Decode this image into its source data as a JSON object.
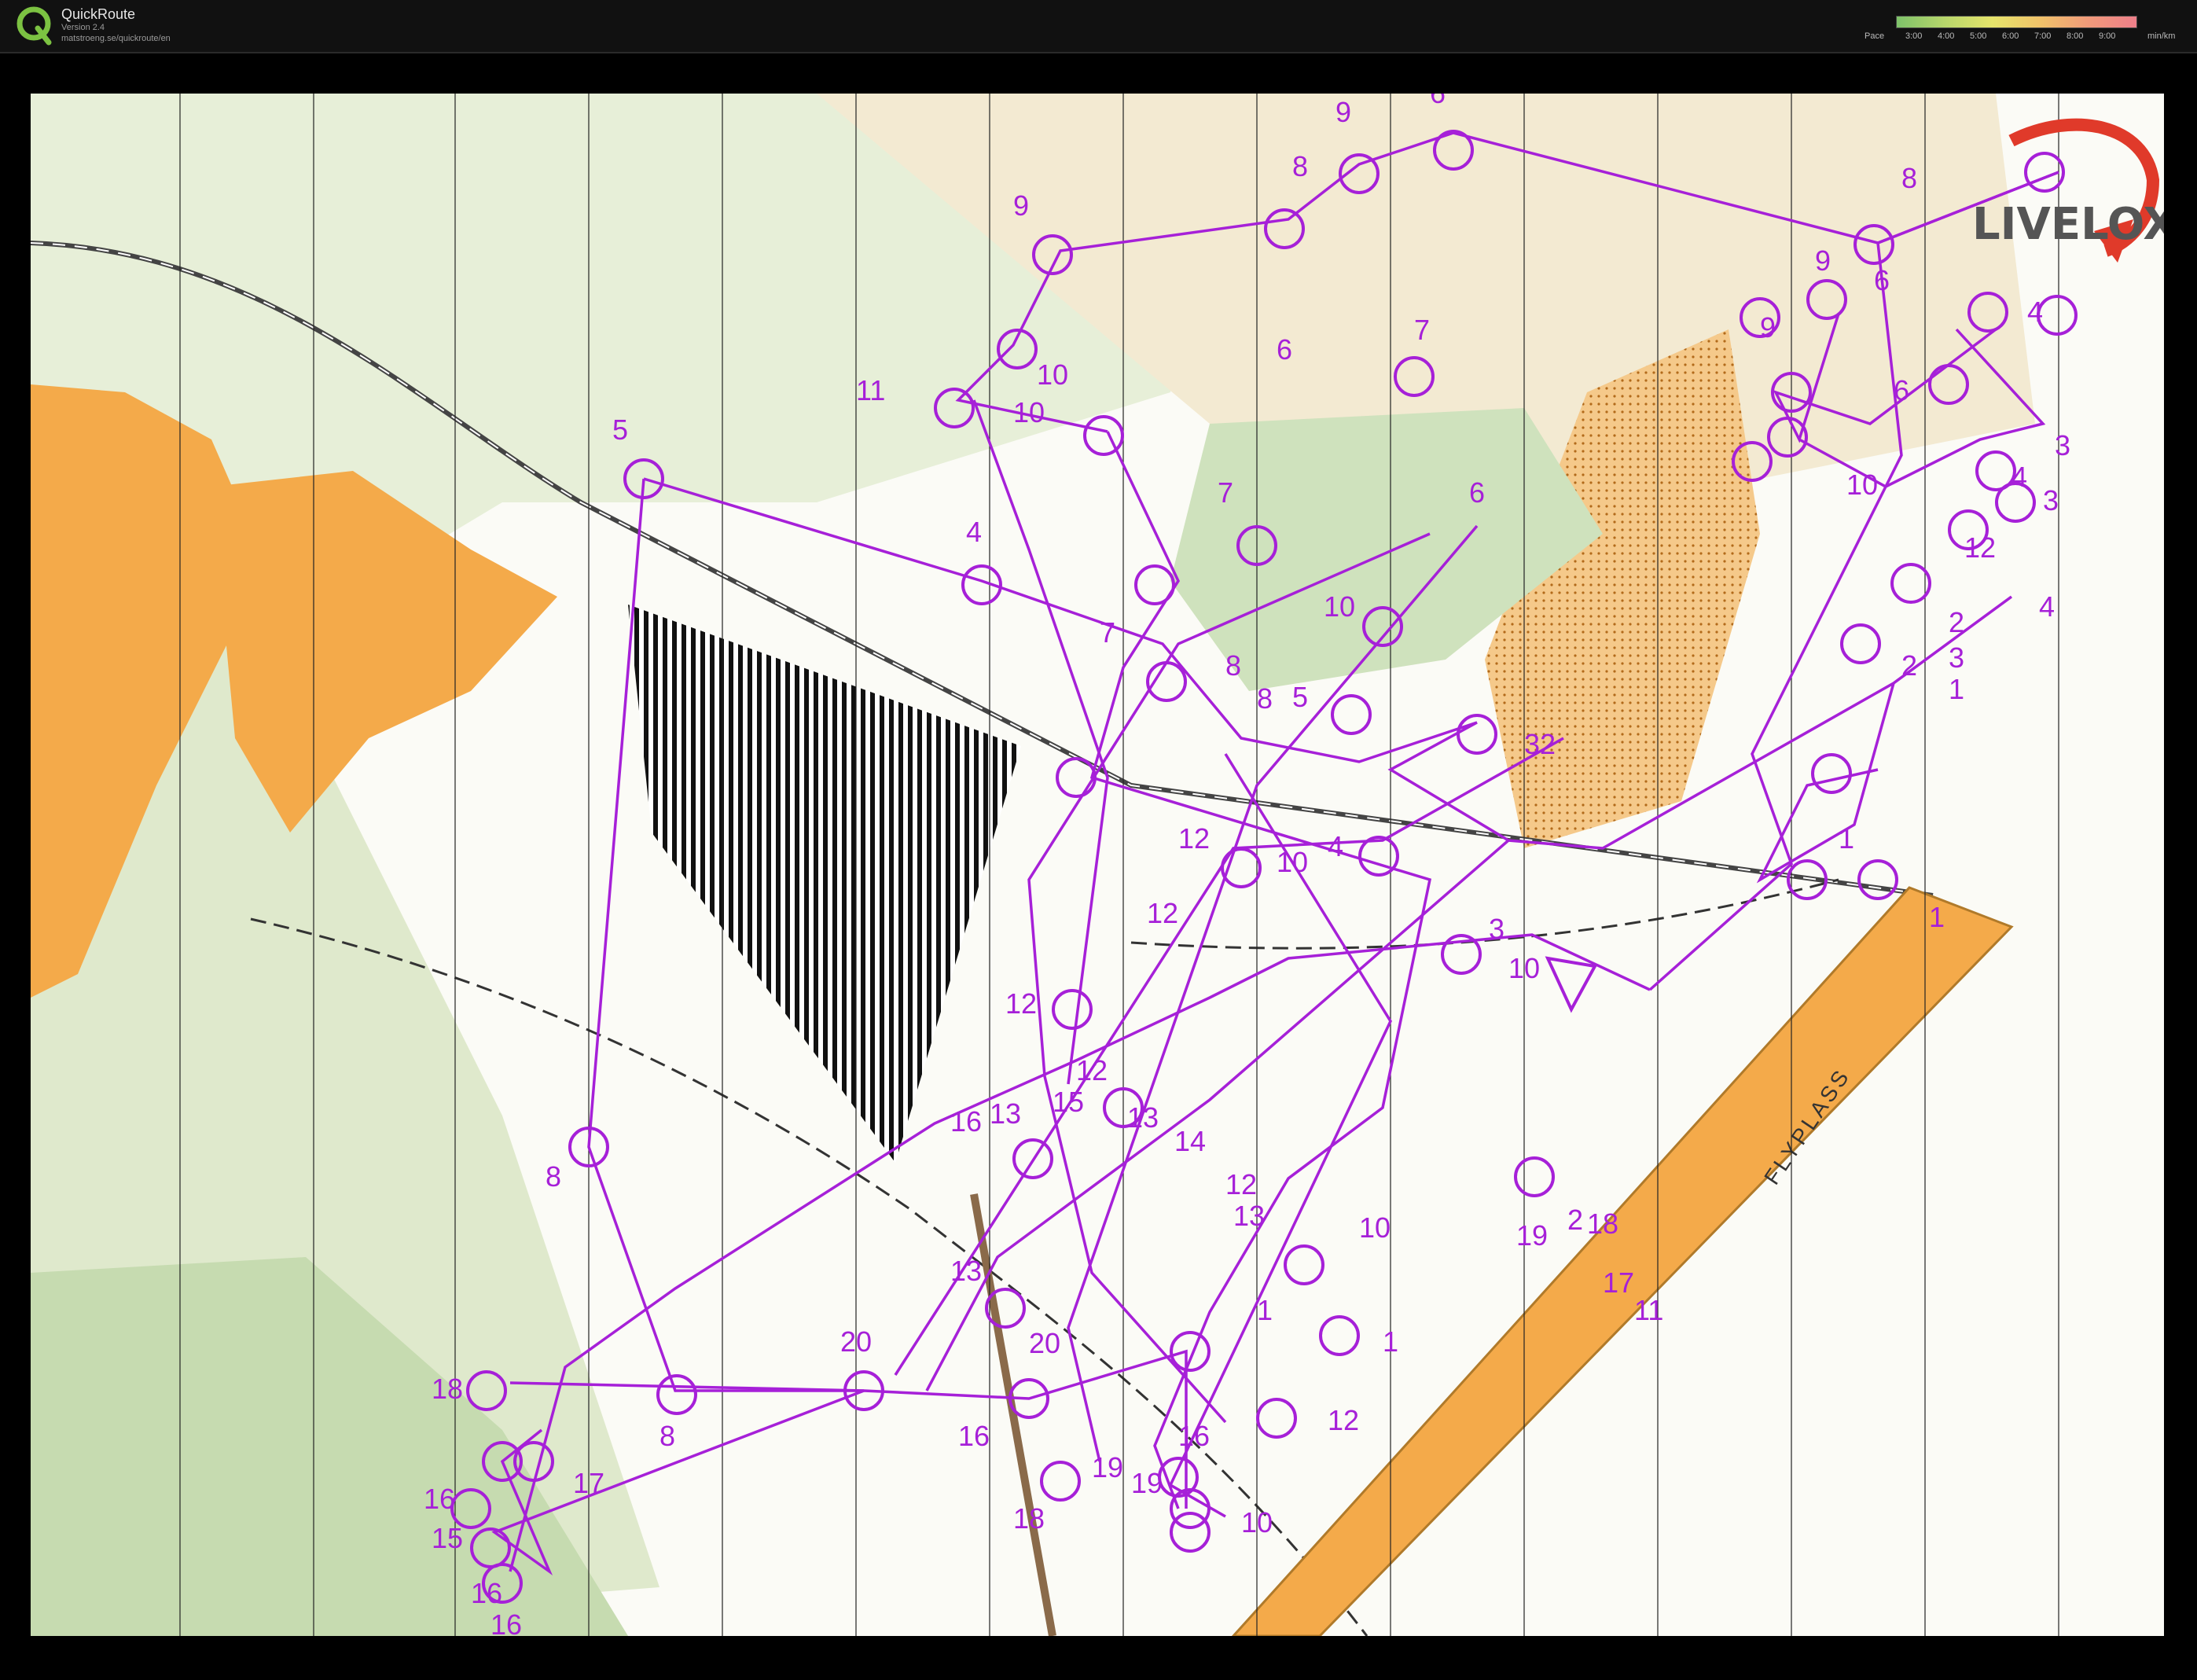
{
  "app": {
    "title": "QuickRoute",
    "version": "Version 2.4",
    "url": "matstroeng.se/quickroute/en"
  },
  "pace_scale": {
    "label": "Pace",
    "unit": "min/km",
    "ticks": [
      "3:00",
      "4:00",
      "5:00",
      "6:00",
      "7:00",
      "8:00",
      "9:00"
    ],
    "gradient_colors": [
      "#7ec26a",
      "#b7d66b",
      "#e6e46b",
      "#f0c26a",
      "#f09a7a",
      "#ee7f8a"
    ]
  },
  "map": {
    "watermark": "LIVELOX",
    "airport_label": "FLYPLASS",
    "course_color": "#a620d8",
    "legend_text": []
  },
  "controls": {
    "labels": [
      "6",
      "9",
      "8",
      "8",
      "8",
      "7",
      "8",
      "9",
      "9",
      "9",
      "6",
      "10",
      "11",
      "10",
      "10",
      "5",
      "4",
      "7",
      "7",
      "6",
      "6",
      "6",
      "4",
      "5",
      "3",
      "4",
      "3",
      "3",
      "2",
      "2",
      "1",
      "1",
      "1",
      "10",
      "10",
      "32",
      "12",
      "12",
      "8",
      "8",
      "12",
      "10",
      "4",
      "4",
      "3",
      "10",
      "12",
      "12",
      "12",
      "13",
      "13",
      "13",
      "15",
      "14",
      "16",
      "2",
      "1",
      "18",
      "1",
      "13",
      "20",
      "20",
      "19",
      "16",
      "16",
      "15",
      "16",
      "16",
      "17",
      "16",
      "18",
      "19",
      "17",
      "18",
      "19",
      "10",
      "12",
      "11"
    ]
  }
}
